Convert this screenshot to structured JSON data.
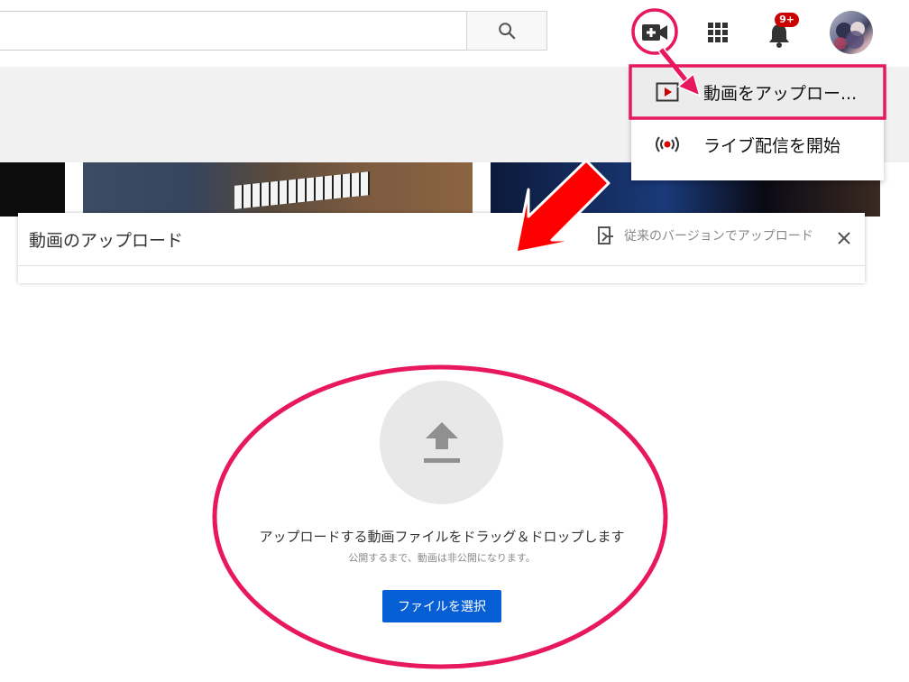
{
  "header": {
    "search_placeholder": "",
    "search_icon": "search-icon",
    "create_icon": "video-camera-plus-icon",
    "apps_icon": "apps-grid-icon",
    "notifications_icon": "bell-icon",
    "notification_badge": "9+"
  },
  "create_menu": {
    "items": [
      {
        "label": "動画をアップロー...",
        "icon": "upload-play-icon"
      },
      {
        "label": "ライブ配信を開始",
        "icon": "live-broadcast-icon"
      }
    ]
  },
  "upload_dialog": {
    "title": "動画のアップロード",
    "legacy_link": "従来のバージョンでアップロード",
    "close_icon": "close-icon",
    "drop_text": "アップロードする動画ファイルをドラッグ＆ドロップします",
    "sub_text": "公開するまで、動画は非公開になります。",
    "select_button": "ファイルを選択",
    "upload_icon": "upload-arrow-icon"
  },
  "colors": {
    "annotation_pink": "#e8185f",
    "annotation_red": "#ff0000",
    "primary_blue": "#065fd4",
    "badge_red": "#cc0000"
  }
}
